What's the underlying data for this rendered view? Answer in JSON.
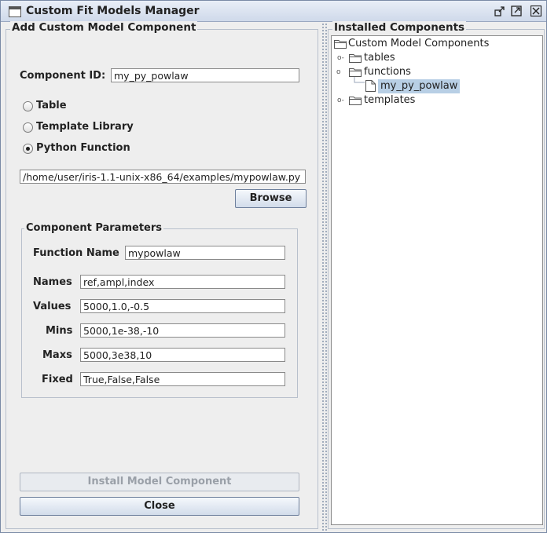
{
  "window": {
    "title": "Custom Fit Models Manager"
  },
  "left": {
    "title": "Add Custom Model Component",
    "component_id_label": "Component ID:",
    "component_id_value": "my_py_powlaw",
    "radios": [
      {
        "label": "Table",
        "checked": false
      },
      {
        "label": "Template Library",
        "checked": false
      },
      {
        "label": "Python Function",
        "checked": true
      }
    ],
    "path_value": "/home/user/iris-1.1-unix-x86_64/examples/mypowlaw.py",
    "browse_label": "Browse",
    "params": {
      "title": "Component Parameters",
      "function_name_label": "Function Name",
      "function_name_value": "mypowlaw",
      "rows": [
        {
          "label": "Names",
          "value": "ref,ampl,index"
        },
        {
          "label": "Values",
          "value": "5000,1.0,-0.5"
        },
        {
          "label": "Mins",
          "value": "5000,1e-38,-10"
        },
        {
          "label": "Maxs",
          "value": "5000,3e38,10"
        },
        {
          "label": "Fixed",
          "value": "True,False,False"
        }
      ]
    },
    "install_label": "Install Model Component",
    "close_label": "Close"
  },
  "right": {
    "title": "Installed Components",
    "tree": {
      "root": "Custom Model Components",
      "tables": "tables",
      "functions": "functions",
      "function_item": "my_py_powlaw",
      "templates": "templates"
    }
  }
}
